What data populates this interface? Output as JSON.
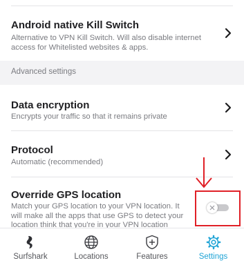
{
  "settings": {
    "kill_switch": {
      "title": "Android native Kill Switch",
      "description": "Alternative to VPN Kill Switch. Will also disable internet access for Whitelisted websites & apps."
    },
    "section_header": "Advanced settings",
    "data_encryption": {
      "title": "Data encryption",
      "description": "Encrypts your traffic so that it remains private"
    },
    "protocol": {
      "title": "Protocol",
      "description": "Automatic (recommended)"
    },
    "override_gps": {
      "title": "Override GPS location",
      "description": "Match your GPS location to your VPN location. It will make all the apps that use GPS to detect your location think that you're in your VPN location",
      "enabled": false
    }
  },
  "bottom_nav": {
    "items": [
      {
        "label": "Surfshark",
        "icon": "surfshark-logo-icon",
        "active": false
      },
      {
        "label": "Locations",
        "icon": "globe-icon",
        "active": false
      },
      {
        "label": "Features",
        "icon": "shield-plus-icon",
        "active": false
      },
      {
        "label": "Settings",
        "icon": "gear-icon",
        "active": true
      }
    ]
  },
  "colors": {
    "accent": "#20a4d6",
    "highlight": "#e01f26",
    "section_bg": "#f3f3f5",
    "toggle_off": "#c9c9cc"
  }
}
